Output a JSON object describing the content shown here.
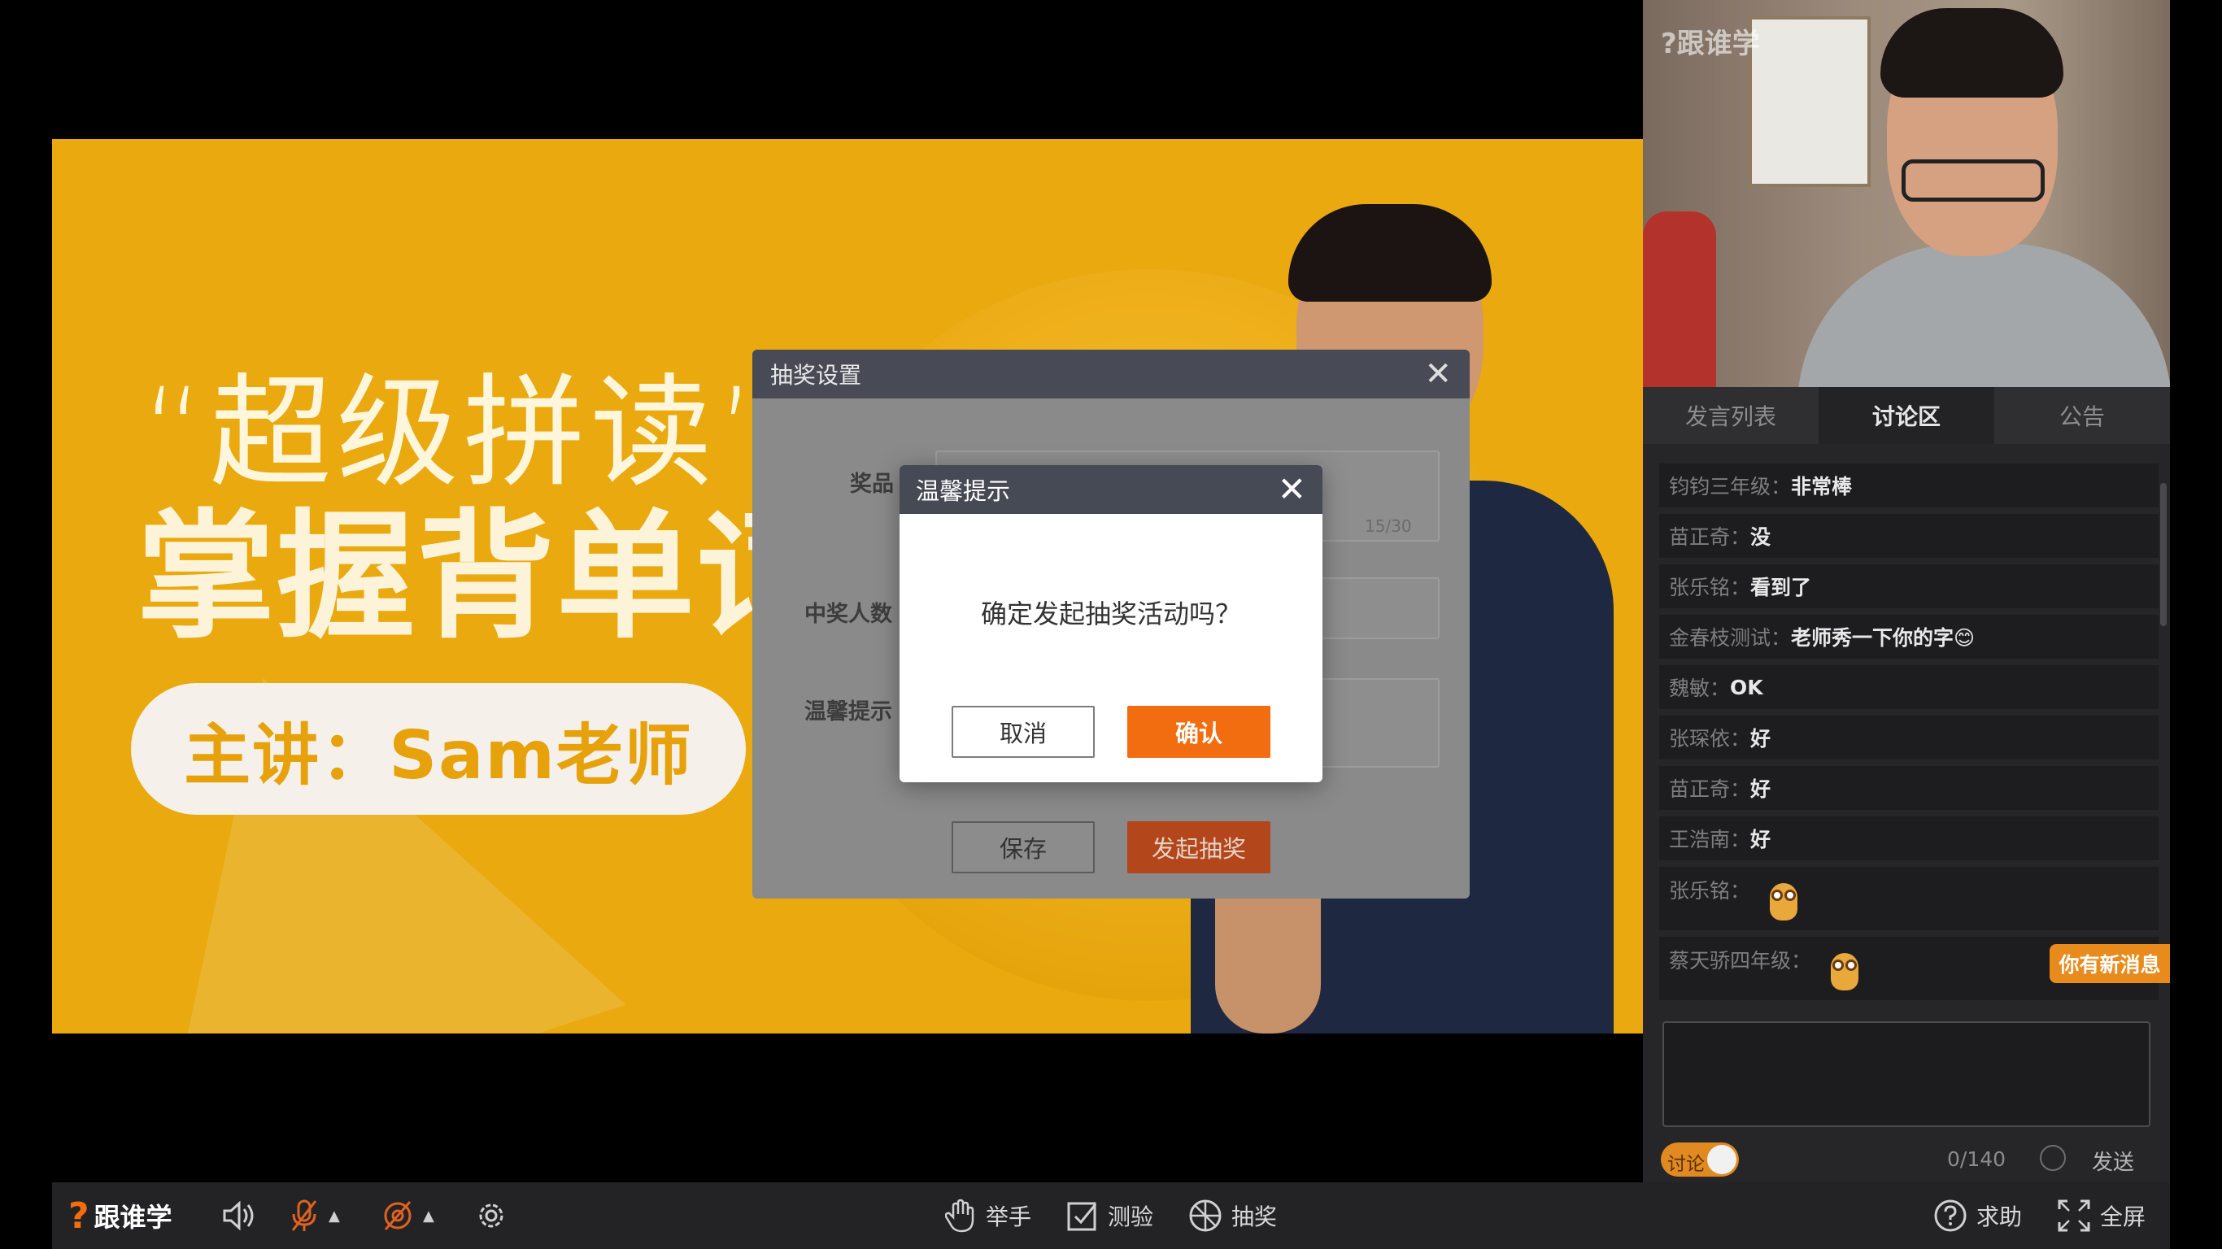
{
  "slide": {
    "quote_line": "“超级拼读”",
    "headline": "掌握背单词",
    "presenter": "主讲：Sam老师"
  },
  "lottery_dialog": {
    "title": "抽奖设置",
    "prize_label": "奖品",
    "prize_counter": "15/30",
    "winners_label": "中奖人数",
    "tip_label": "温馨提示",
    "save_label": "保存",
    "start_label": "发起抽奖"
  },
  "confirm_dialog": {
    "title": "温馨提示",
    "message": "确定发起抽奖活动吗？",
    "cancel_label": "取消",
    "ok_label": "确认"
  },
  "video": {
    "watermark": "?跟谁学"
  },
  "sidebar": {
    "tabs": [
      {
        "label": "发言列表",
        "active": false
      },
      {
        "label": "讨论区",
        "active": true
      },
      {
        "label": "公告",
        "active": false
      }
    ],
    "messages": [
      {
        "name": "钧钧三年级：",
        "text": "非常棒"
      },
      {
        "name": "苗正奇：",
        "text": "没"
      },
      {
        "name": "张乐铭：",
        "text": "看到了"
      },
      {
        "name": "金春枝测试：",
        "text": "老师秀一下你的字😊"
      },
      {
        "name": "魏敏：",
        "text": "OK"
      },
      {
        "name": "张琛依：",
        "text": "好"
      },
      {
        "name": "苗正奇：",
        "text": "好"
      },
      {
        "name": "王浩南：",
        "text": "好"
      },
      {
        "name": "张乐铭：",
        "sticker": "owl-sticker"
      },
      {
        "name": "蔡天骄四年级：",
        "sticker": "owl-sticker"
      }
    ],
    "new_message_badge": "你有新消息",
    "toggle_label": "讨论",
    "char_counter": "0/140",
    "send_label": "发送"
  },
  "toolbar": {
    "brand_mark": "?",
    "brand_name": "跟谁学",
    "raise_hand": "举手",
    "quiz": "测验",
    "lottery": "抽奖",
    "help": "求助",
    "fullscreen": "全屏"
  },
  "colors": {
    "accent": "#f26d0f",
    "slide_bg": "#e9a90f",
    "panel_bg": "#262628",
    "muted_icon": "#e0621e"
  }
}
